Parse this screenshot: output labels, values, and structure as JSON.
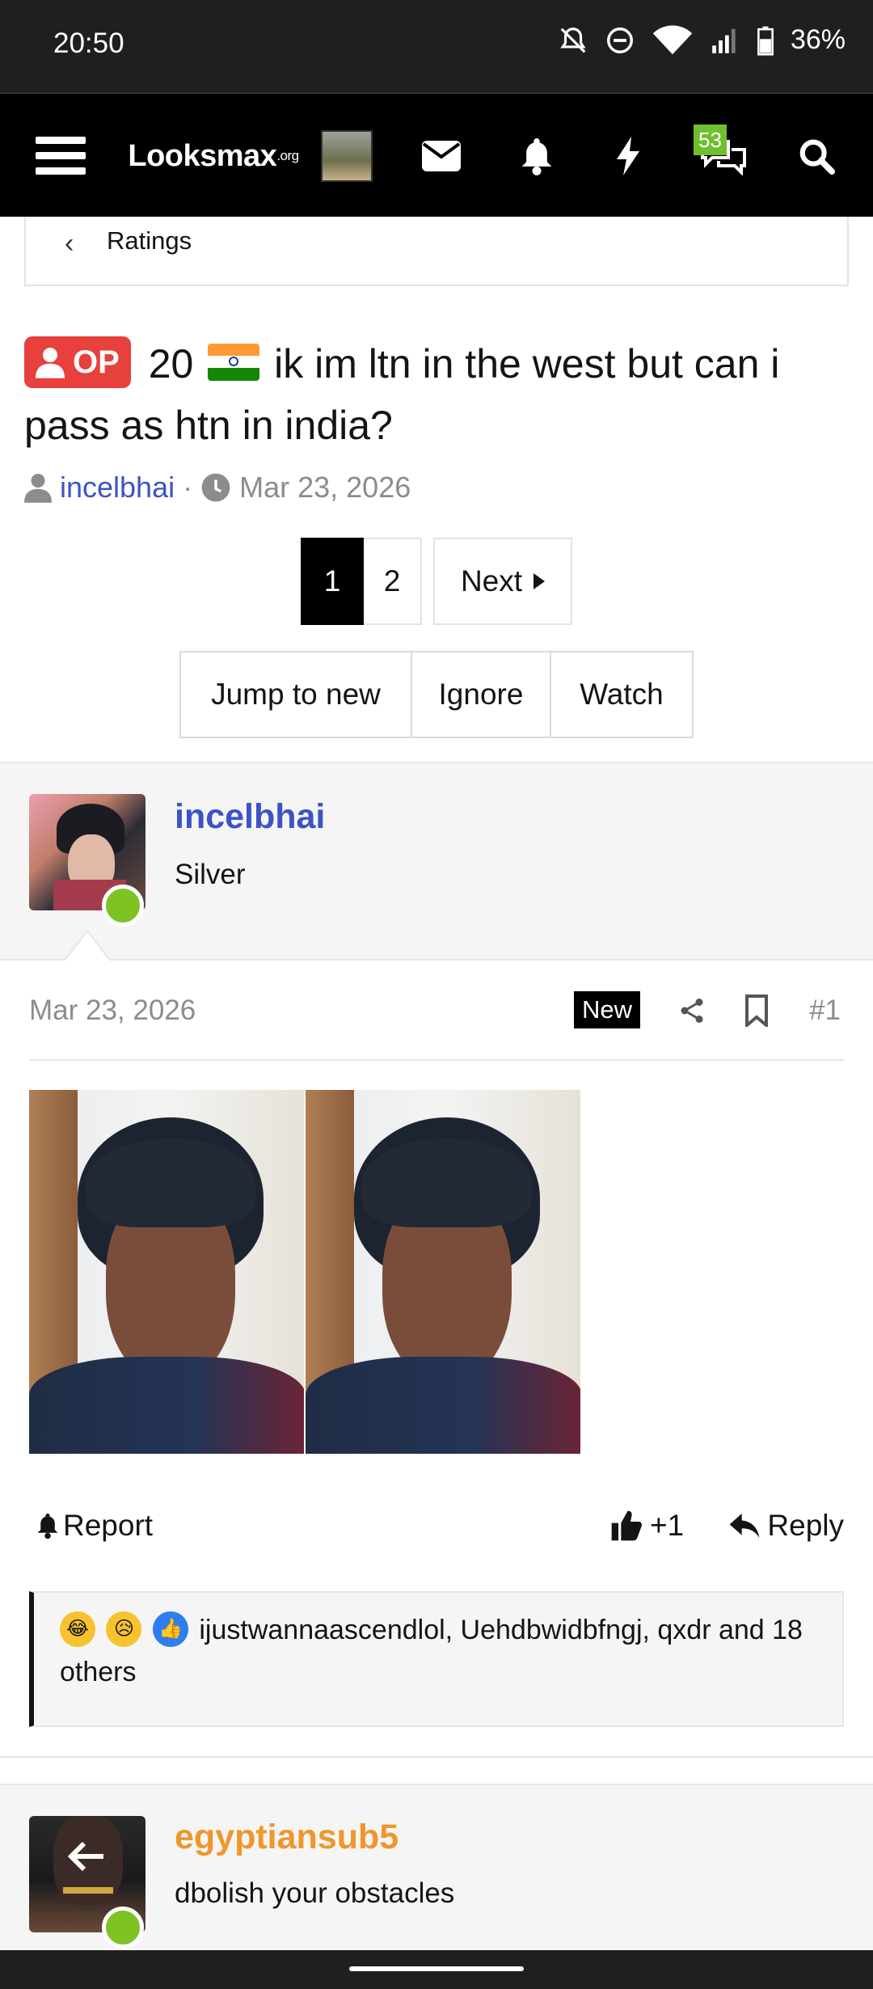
{
  "status_bar": {
    "time": "20:50",
    "battery": "36%"
  },
  "nav": {
    "logo": "Looksmax",
    "logo_suffix": ".org",
    "messages_badge": "53"
  },
  "breadcrumb": {
    "label": "Ratings"
  },
  "thread": {
    "op_label": "OP",
    "title_prefix": "20",
    "title_text": "ik im ltn in the west but can i pass as htn in india?",
    "author": "incelbhai",
    "separator": "·",
    "date": "Mar 23, 2026"
  },
  "pagination": {
    "pages": [
      "1",
      "2"
    ],
    "next": "Next"
  },
  "thread_actions": {
    "jump": "Jump to new",
    "ignore": "Ignore",
    "watch": "Watch"
  },
  "post": {
    "username": "incelbhai",
    "user_title": "Silver",
    "date": "Mar 23, 2026",
    "new_label": "New",
    "number": "#1",
    "report": "Report",
    "like_count": "+1",
    "reply": "Reply",
    "reactions_text": "ijustwannaascendlol, Uehdbwidbfngj, qxdr and 18 others"
  },
  "next_post": {
    "username": "egyptiansub5",
    "user_title": "dbolish your obstacles"
  },
  "colors": {
    "link": "#3b54c5",
    "op_badge": "#e8403c",
    "online": "#7cc323",
    "orange_user": "#f0962c"
  }
}
